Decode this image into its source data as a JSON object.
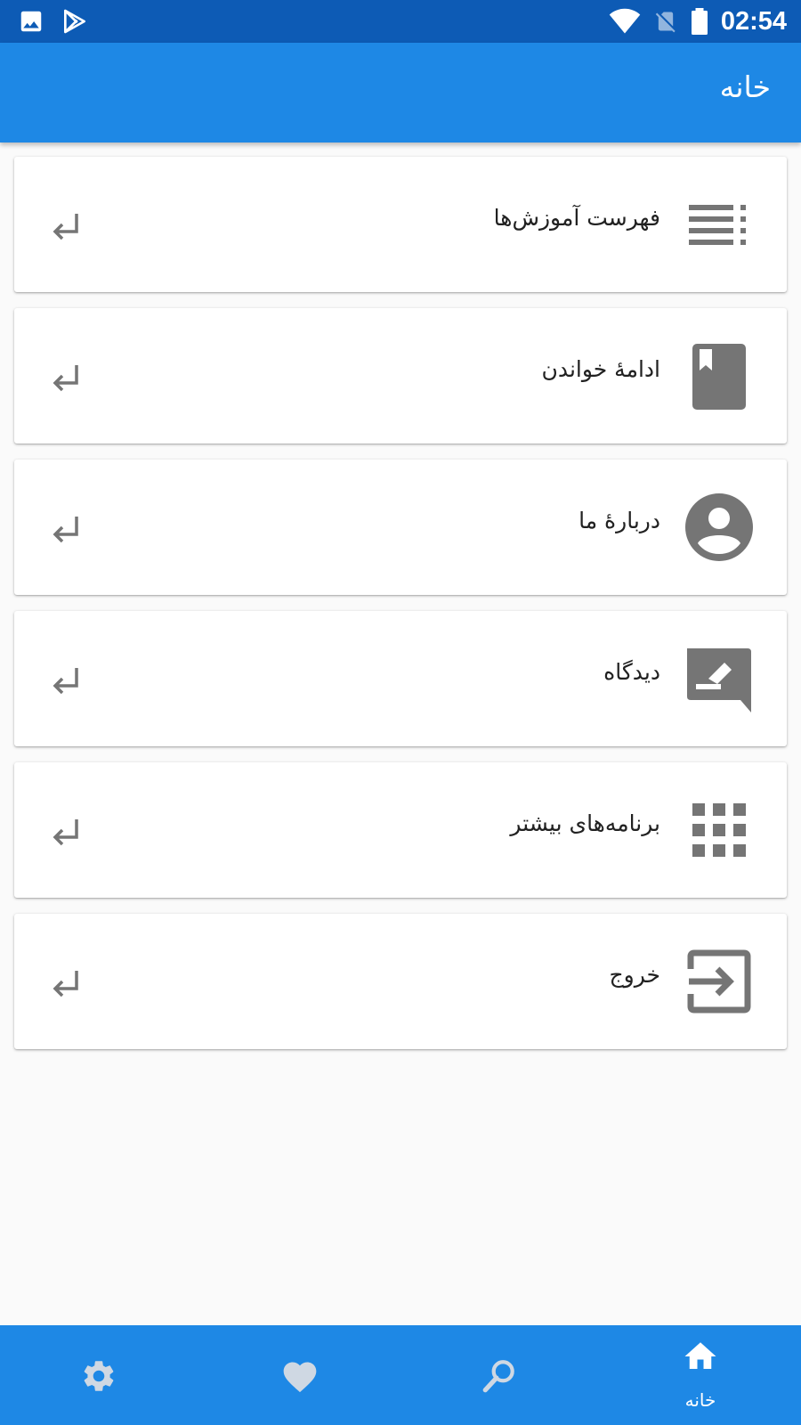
{
  "status_bar": {
    "time": "02:54",
    "icons": [
      "image-icon",
      "play-store-icon",
      "wifi-icon",
      "no-sim-icon",
      "battery-icon"
    ]
  },
  "app_bar": {
    "title": "خانه"
  },
  "menu": {
    "items": [
      {
        "label": "فهرست آموزش‌ها",
        "icon": "list-icon"
      },
      {
        "label": "ادامهٔ خواندن",
        "icon": "bookmark-book-icon"
      },
      {
        "label": "دربارهٔ ما",
        "icon": "account-circle-icon"
      },
      {
        "label": "دیدگاه",
        "icon": "feedback-icon"
      },
      {
        "label": "برنامه‌های بیشتر",
        "icon": "apps-grid-icon"
      },
      {
        "label": "خروج",
        "icon": "exit-icon"
      }
    ],
    "item_arrow_icon": "return-arrow-icon"
  },
  "bottom_nav": {
    "home_label": "خانه",
    "items": [
      "settings-icon",
      "heart-icon",
      "search-icon",
      "home-icon"
    ]
  },
  "colors": {
    "status_bar": "#0d5bb5",
    "primary": "#1e88e5",
    "icon_grey": "#757575",
    "background": "#fafafa"
  }
}
